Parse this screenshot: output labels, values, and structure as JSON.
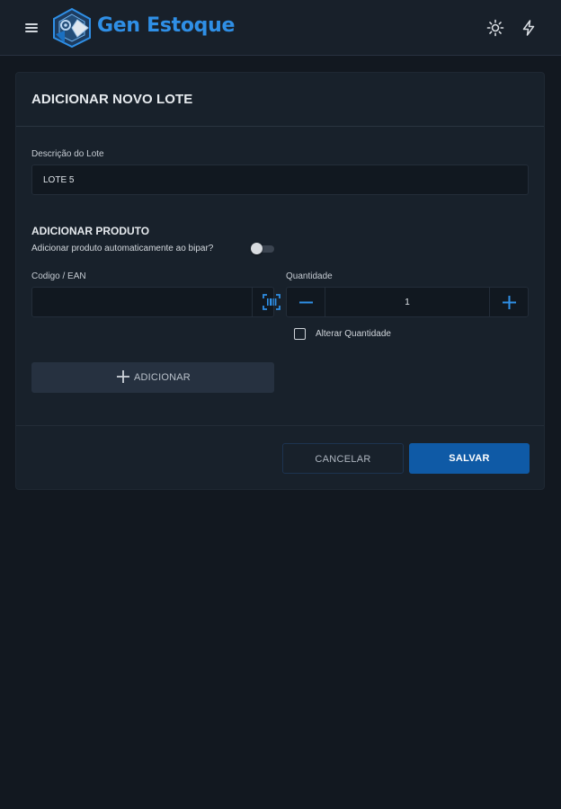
{
  "header": {
    "brand": "Gen Estoque",
    "icons": {
      "menu": "menu-icon",
      "logo": "gen-estoque-logo",
      "theme": "sun-icon",
      "action": "bolt-icon"
    }
  },
  "form": {
    "title": "ADICIONAR NOVO LOTE",
    "description_label": "Descrição do Lote",
    "description_value": "LOTE 5",
    "product_section_title": "ADICIONAR PRODUTO",
    "auto_add_label": "Adicionar produto automaticamente ao bipar?",
    "auto_add_enabled": false,
    "code_label": "Codigo / EAN",
    "code_value": "",
    "quantity_label": "Quantidade",
    "quantity_value": "1",
    "alter_quantity_label": "Alterar Quantidade",
    "alter_quantity_checked": false,
    "add_button": "ADICIONAR",
    "cancel_button": "CANCELAR",
    "save_button": "SALVAR"
  },
  "colors": {
    "background": "#121820",
    "card": "#18212b",
    "accent": "#2f8fe6",
    "primary_button": "#0f5aa6"
  }
}
